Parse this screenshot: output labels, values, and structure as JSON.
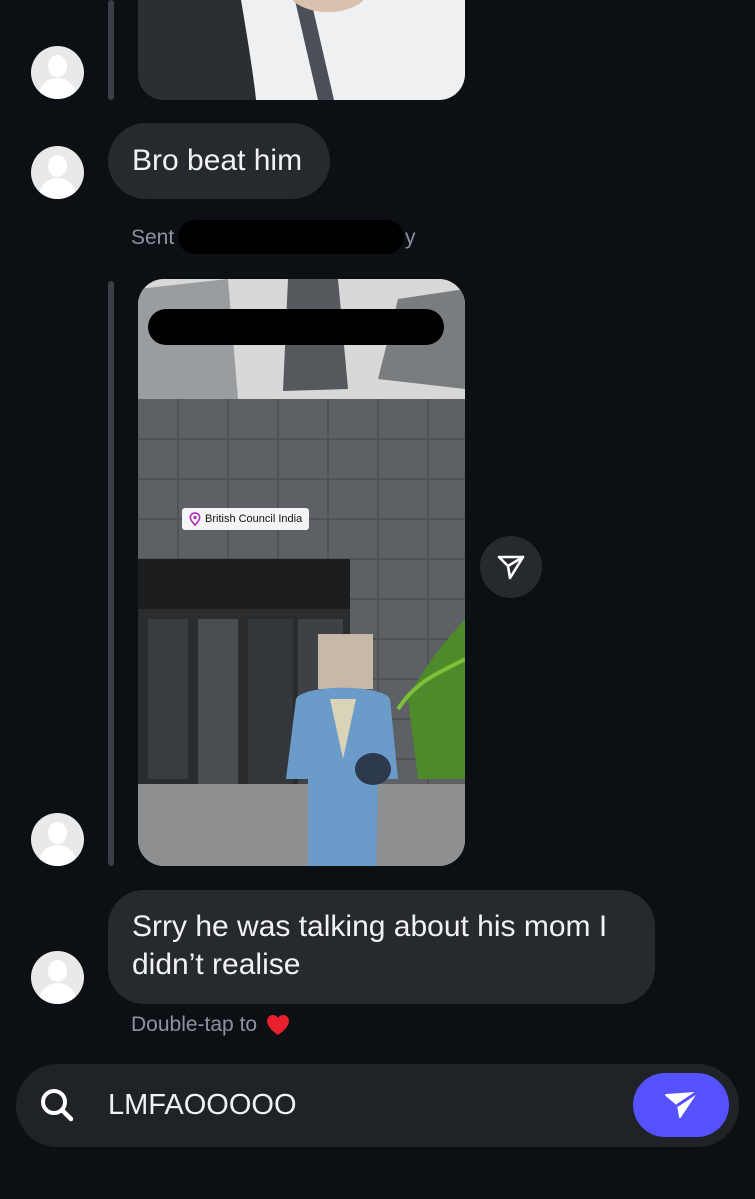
{
  "messages": [
    {
      "type": "text",
      "text": "Bro beat him"
    },
    {
      "type": "story_reply",
      "meta_label": "Sent",
      "meta_suffix": "y",
      "location_tag": "British Council India"
    },
    {
      "type": "text",
      "lines": [
        "Srry he was talking about his mom I",
        "didn’t realise"
      ],
      "hint": "Double-tap to"
    }
  ],
  "composer": {
    "value": "LMFAOOOOO"
  },
  "icons": {
    "avatar": "default-avatar-icon",
    "share": "paper-plane-icon",
    "search": "search-icon",
    "send": "send-icon",
    "heart": "heart-icon"
  },
  "colors": {
    "background": "#0c1014",
    "bubble": "#262a2f",
    "send": "#5551ff",
    "heart": "#e8202e"
  }
}
